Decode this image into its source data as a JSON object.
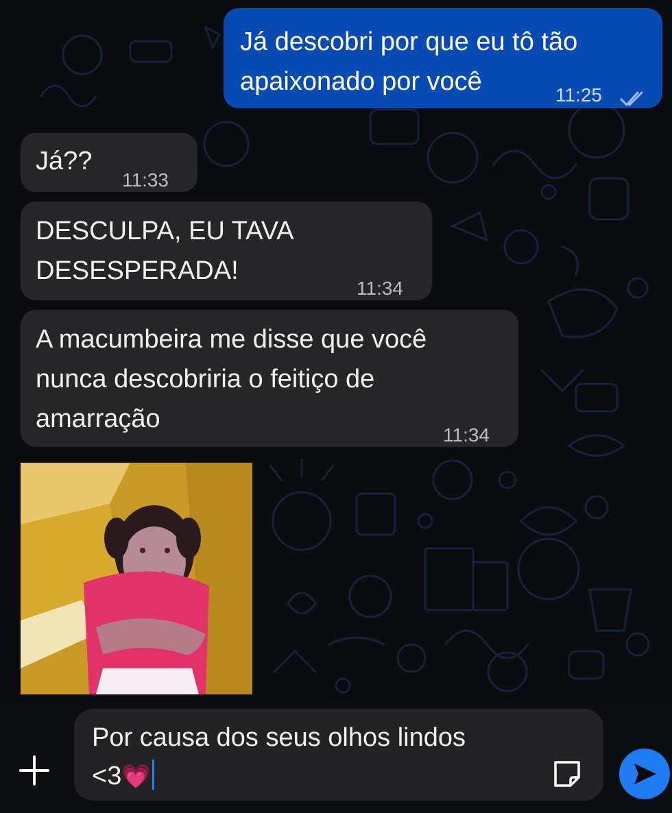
{
  "messages": [
    {
      "direction": "outgoing",
      "lines": [
        "Já descobri por que eu tô tão",
        "apaixonado por você"
      ],
      "time": "11:25",
      "status_icon": "double-check-icon"
    },
    {
      "direction": "incoming",
      "lines": [
        "Já??"
      ],
      "time": "11:33"
    },
    {
      "direction": "incoming",
      "lines": [
        "DESCULPA, EU TAVA",
        "DESESPERADA!"
      ],
      "time": "11:34"
    },
    {
      "direction": "incoming",
      "lines": [
        "A macumbeira me disse que você",
        "nunca descobriria o feitiço de",
        "amarração"
      ],
      "time": "11:34"
    },
    {
      "direction": "incoming",
      "type": "image"
    }
  ],
  "composer": {
    "text_line1": "Por causa dos seus olhos lindos",
    "text_line2": "<3",
    "emoji": "💗",
    "add_icon": "plus-icon",
    "sticker_icon": "sticker-icon",
    "send_icon": "send-icon"
  },
  "colors": {
    "outgoing_bubble": "#0a4bb3",
    "incoming_bubble": "#262628",
    "send_button": "#1e7bf2",
    "caret": "#2f7cf6"
  }
}
